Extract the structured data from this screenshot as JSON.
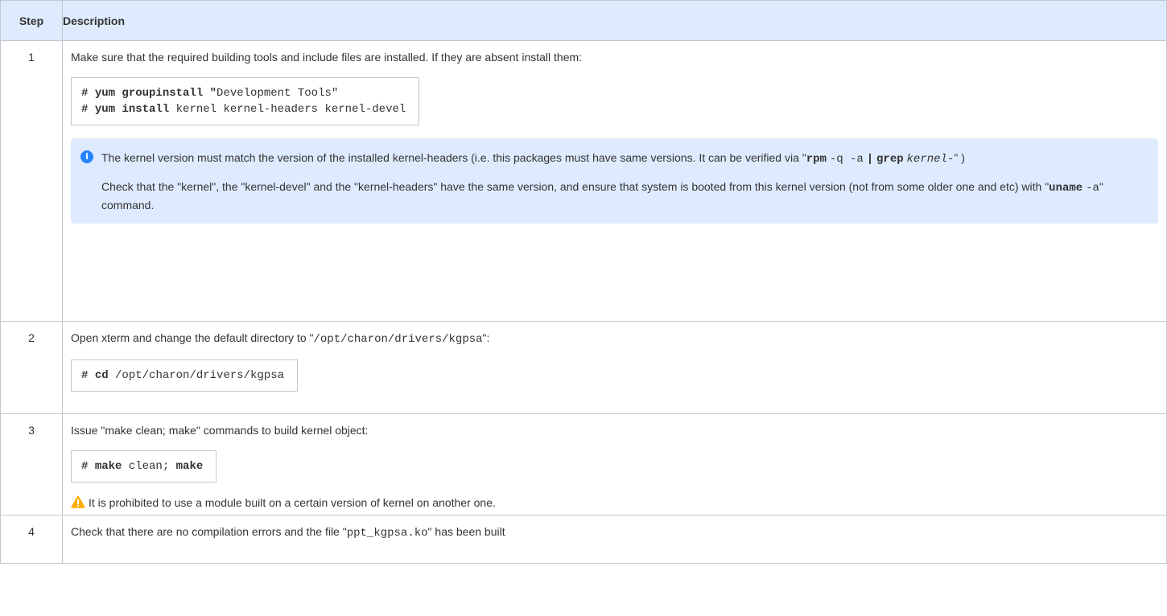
{
  "headers": {
    "step": "Step",
    "description": "Description"
  },
  "step1": {
    "number": "1",
    "text": "Make sure that the required building tools and include files are installed. If they are absent install them:",
    "code": [
      {
        "hash": "#",
        "cmd": "yum groupinstall",
        "q": "\"",
        "arg": "Development Tools\""
      },
      {
        "hash": "#",
        "cmd": "yum install",
        "arg": "kernel kernel-headers kernel-devel"
      }
    ],
    "info": {
      "icon": "info-icon",
      "p1_text": "The kernel version must match the version of the installed kernel-headers (i.e. this packages must have same versions. It can be verified via \"",
      "p1_rpm": "rpm",
      "p1_args": "-q -a",
      "p1_pipe": "|",
      "p1_grep": "grep",
      "p1_kernel": "kernel-",
      "p1_end": "\" )",
      "p2_text": "Check that the \"kernel\", the \"kernel-devel\" and the \"kernel-headers\" have the same version, and ensure that system is booted from this kernel version (not from some older one and etc) with \"",
      "p2_cmd": "uname",
      "p2_arg": "-a",
      "p2_end": "\" command."
    }
  },
  "step2": {
    "number": "2",
    "text_before": "Open xterm and change the default directory to \"",
    "path": "/opt/charon/drivers/kgpsa",
    "text_after": "\":",
    "code_hash": "#",
    "code_cmd": "cd",
    "code_arg": "/opt/charon/drivers/kgpsa"
  },
  "step3": {
    "number": "3",
    "text": "Issue \"make clean; make\" commands to build kernel object:",
    "code_hash": "#",
    "code_cmd1": "make",
    "code_arg": "clean;",
    "code_cmd2": "make",
    "warning": "It is prohibited to use a module built on a certain version of kernel on another one.",
    "warning_icon": "warning-icon"
  },
  "step4": {
    "number": "4",
    "text_before": "Check that there are no compilation errors and the file \"",
    "file": "ppt_kgpsa.ko",
    "text_after": "\" has been built"
  },
  "colors": {
    "header_bg": "#deebff",
    "info_bg": "#deebff",
    "border": "#c1c7d0",
    "info_icon": "#2684ff",
    "warning_icon": "#ffab00"
  }
}
